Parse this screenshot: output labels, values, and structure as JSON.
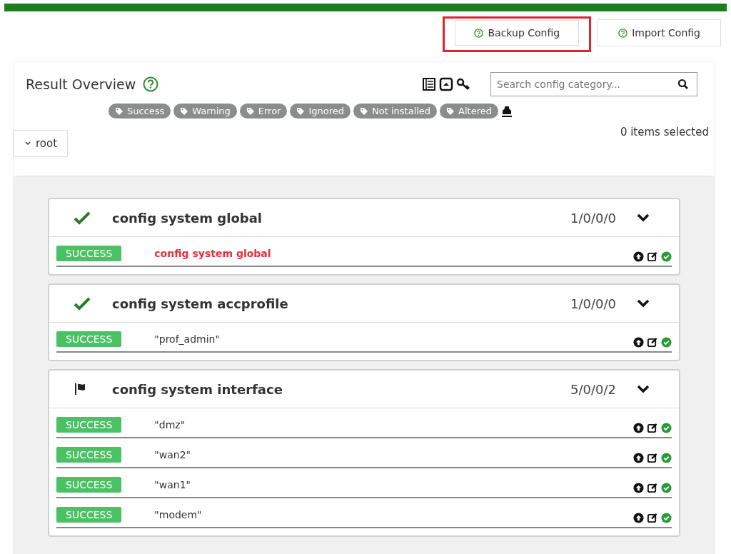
{
  "top_buttons": [
    {
      "label": "Backup Config",
      "highlighted": true
    },
    {
      "label": "Import Config",
      "highlighted": false
    }
  ],
  "overview": {
    "title": "Result Overview",
    "search": {
      "placeholder": "Search config category..."
    },
    "filters": [
      "Success",
      "Warning",
      "Error",
      "Ignored",
      "Not installed",
      "Altered"
    ],
    "selection": "0 items selected",
    "root": "root"
  },
  "sections": [
    {
      "kind": "check",
      "title": "config system global",
      "counts": "1/0/0/0",
      "items": [
        {
          "status": "SUCCESS",
          "name": "config system global",
          "emphasis": true
        }
      ]
    },
    {
      "kind": "check",
      "title": "config system accprofile",
      "counts": "1/0/0/0",
      "items": [
        {
          "status": "SUCCESS",
          "name": "\"prof_admin\"",
          "emphasis": false
        }
      ]
    },
    {
      "kind": "flag",
      "title": "config system interface",
      "counts": "5/0/0/2",
      "items": [
        {
          "status": "SUCCESS",
          "name": "\"dmz\"",
          "emphasis": false
        },
        {
          "status": "SUCCESS",
          "name": "\"wan2\"",
          "emphasis": false
        },
        {
          "status": "SUCCESS",
          "name": "\"wan1\"",
          "emphasis": false
        },
        {
          "status": "SUCCESS",
          "name": "\"modem\"",
          "emphasis": false
        }
      ]
    }
  ]
}
